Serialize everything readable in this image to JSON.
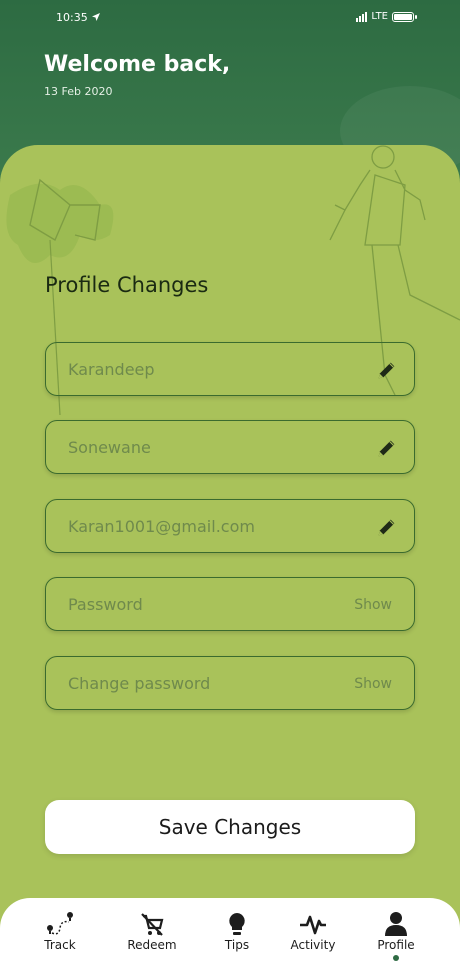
{
  "status_bar": {
    "time": "10:35",
    "network": "LTE"
  },
  "header": {
    "greeting": "Welcome back,",
    "date": "13 Feb 2020"
  },
  "form": {
    "title": "Profile Changes",
    "first_name": "Karandeep",
    "last_name": "Sonewane",
    "email": "Karan1001@gmail.com",
    "password_placeholder": "Password",
    "password_show": "Show",
    "change_password_placeholder": "Change password",
    "change_password_show": "Show"
  },
  "save_button": "Save Changes",
  "tabs": [
    {
      "label": "Track",
      "icon": "route-icon"
    },
    {
      "label": "Redeem",
      "icon": "cart-off-icon"
    },
    {
      "label": "Tips",
      "icon": "lightbulb-icon"
    },
    {
      "label": "Activity",
      "icon": "pulse-icon"
    },
    {
      "label": "Profile",
      "icon": "user-icon",
      "active": true
    }
  ],
  "colors": {
    "header": "#2f6b43",
    "card": "#a9c25a",
    "field_border": "#3b6b2e"
  }
}
